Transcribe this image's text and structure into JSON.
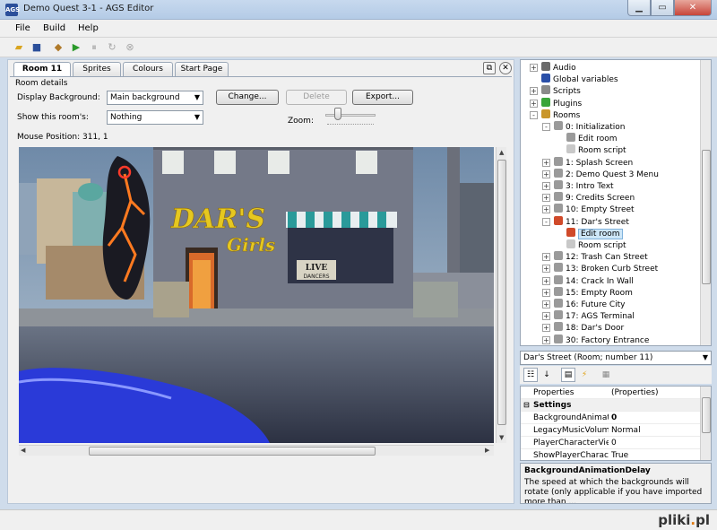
{
  "window": {
    "title": "Demo Quest 3-1 - AGS Editor",
    "app_icon": "AGS"
  },
  "menu": [
    "File",
    "Build",
    "Help"
  ],
  "tabs": [
    "Room 11",
    "Sprites",
    "Colours",
    "Start Page"
  ],
  "room_details": {
    "group_label": "Room details",
    "display_bg_label": "Display Background:",
    "display_bg_value": "Main background",
    "show_room_label": "Show this room's:",
    "show_room_value": "Nothing",
    "mouse_position": "Mouse Position: 311, 1",
    "zoom_label": "Zoom:",
    "buttons": {
      "change": "Change...",
      "delete": "Delete",
      "export": "Export..."
    }
  },
  "room_scene": {
    "sign_main": "DAR'S",
    "sign_sub": "Girls",
    "live_sign_line1": "LIVE",
    "live_sign_line2": "DANCERS"
  },
  "tree": [
    {
      "label": "Audio",
      "level": 1,
      "expander": "+",
      "icon": "speaker-icon",
      "color": "#6a6a6a"
    },
    {
      "label": "Global variables",
      "level": 1,
      "expander": "",
      "icon": "globe-icon",
      "color": "#2a4fa8"
    },
    {
      "label": "Scripts",
      "level": 1,
      "expander": "+",
      "icon": "scripts-icon",
      "color": "#8a8a8a"
    },
    {
      "label": "Plugins",
      "level": 1,
      "expander": "+",
      "icon": "puzzle-icon",
      "color": "#3aa53a"
    },
    {
      "label": "Rooms",
      "level": 1,
      "expander": "-",
      "icon": "rooms-icon",
      "color": "#c9962a"
    },
    {
      "label": "0: Initialization",
      "level": 2,
      "expander": "-",
      "icon": "room-icon",
      "color": "#9a9a9a"
    },
    {
      "label": "Edit room",
      "level": 3,
      "expander": "",
      "icon": "edit-room-icon",
      "color": "#9a9a9a"
    },
    {
      "label": "Room script",
      "level": 3,
      "expander": "",
      "icon": "room-script-icon",
      "color": "#c8c8c8"
    },
    {
      "label": "1: Splash Screen",
      "level": 2,
      "expander": "+",
      "icon": "room-icon",
      "color": "#9a9a9a"
    },
    {
      "label": "2: Demo Quest 3 Menu",
      "level": 2,
      "expander": "+",
      "icon": "room-icon",
      "color": "#9a9a9a"
    },
    {
      "label": "3: Intro Text",
      "level": 2,
      "expander": "+",
      "icon": "room-icon",
      "color": "#9a9a9a"
    },
    {
      "label": "9: Credits Screen",
      "level": 2,
      "expander": "+",
      "icon": "room-icon",
      "color": "#9a9a9a"
    },
    {
      "label": "10: Empty Street",
      "level": 2,
      "expander": "+",
      "icon": "room-icon",
      "color": "#9a9a9a"
    },
    {
      "label": "11: Dar's Street",
      "level": 2,
      "expander": "-",
      "icon": "room-active-icon",
      "color": "#d04a2a"
    },
    {
      "label": "Edit room",
      "level": 3,
      "expander": "",
      "icon": "edit-room-active-icon",
      "color": "#d04a2a",
      "selected": true
    },
    {
      "label": "Room script",
      "level": 3,
      "expander": "",
      "icon": "room-script-icon",
      "color": "#c8c8c8"
    },
    {
      "label": "12: Trash Can Street",
      "level": 2,
      "expander": "+",
      "icon": "room-icon",
      "color": "#9a9a9a"
    },
    {
      "label": "13: Broken Curb Street",
      "level": 2,
      "expander": "+",
      "icon": "room-icon",
      "color": "#9a9a9a"
    },
    {
      "label": "14: Crack In Wall",
      "level": 2,
      "expander": "+",
      "icon": "room-icon",
      "color": "#9a9a9a"
    },
    {
      "label": "15: Empty Room",
      "level": 2,
      "expander": "+",
      "icon": "room-icon",
      "color": "#9a9a9a"
    },
    {
      "label": "16: Future City",
      "level": 2,
      "expander": "+",
      "icon": "room-icon",
      "color": "#9a9a9a"
    },
    {
      "label": "17: AGS Terminal",
      "level": 2,
      "expander": "+",
      "icon": "room-icon",
      "color": "#9a9a9a"
    },
    {
      "label": "18: Dar's Door",
      "level": 2,
      "expander": "+",
      "icon": "room-icon",
      "color": "#9a9a9a"
    },
    {
      "label": "30: Factory Entrance",
      "level": 2,
      "expander": "+",
      "icon": "room-icon",
      "color": "#9a9a9a"
    }
  ],
  "properties": {
    "selector": "Dar's Street (Room; number 11)",
    "rows": [
      {
        "name": "Properties",
        "value": "(Properties)",
        "type": "row"
      },
      {
        "name": "Settings",
        "value": "",
        "type": "category"
      },
      {
        "name": "BackgroundAnimatior",
        "value": "0",
        "type": "row",
        "bold": true
      },
      {
        "name": "LegacyMusicVolumeA",
        "value": "Normal",
        "type": "row"
      },
      {
        "name": "PlayerCharacterView",
        "value": "0",
        "type": "row"
      },
      {
        "name": "ShowPlayerCharacte",
        "value": "True",
        "type": "row"
      }
    ],
    "desc_title": "BackgroundAnimationDelay",
    "desc_text": "The speed at which the backgrounds will rotate (only applicable if you have imported more than ..."
  },
  "watermark": {
    "brand": "plikipl"
  }
}
